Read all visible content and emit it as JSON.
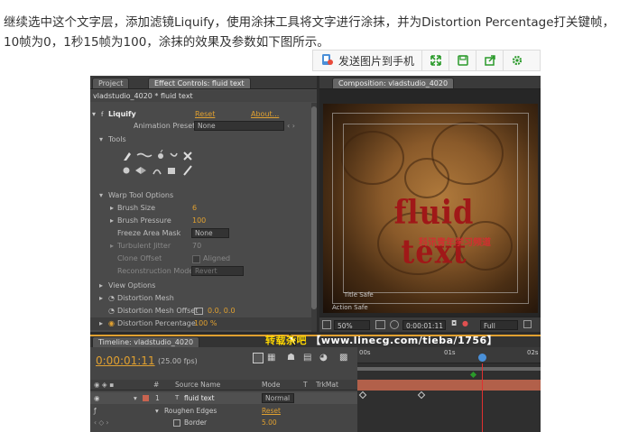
{
  "intro": {
    "text": "继续选中这个文字层，添加滤镜Liquify，使用涂抹工具将文字进行涂抹，并为Distortion Percentage打关键帧，10帧为0，1秒15帧为100，涂抹的效果及参数如下图所示。"
  },
  "sharebar": {
    "send_label": "发送图片到手机",
    "icons": [
      "phone-send-icon",
      "expand-icon",
      "save-icon",
      "share-icon",
      "settings-icon"
    ],
    "accent": "#2a9a2a"
  },
  "ae": {
    "left_tabs": [
      "Project",
      "Effect Controls: fluid text"
    ],
    "layer_path": "vladstudio_4020 * fluid text",
    "effect": {
      "name": "Liquify",
      "reset": "Reset",
      "about": "About...",
      "presets_label": "Animation Presets:",
      "presets_value": "None"
    },
    "tools_label": "Tools",
    "warp_label": "Warp Tool Options",
    "params": [
      {
        "label": "Brush Size",
        "value": "6",
        "active": true
      },
      {
        "label": "Brush Pressure",
        "value": "100",
        "active": true
      },
      {
        "label": "Freeze Area Mask",
        "value": "None",
        "active": true
      },
      {
        "label": "Turbulent Jitter",
        "value": "70",
        "active": false
      },
      {
        "label": "Clone Offset",
        "value": "Aligned",
        "active": false
      },
      {
        "label": "Reconstruction Mode",
        "value": "Revert",
        "active": false
      }
    ],
    "view_options": "View Options",
    "distortion_mesh": "Distortion Mesh",
    "mesh_offset_label": "Distortion Mesh Offset",
    "mesh_offset_value": "0.0, 0.0",
    "distortion_pct_label": "Distortion Percentage",
    "distortion_pct_value": "100 %",
    "comp_tab": "Composition: vladstudio_4020",
    "comp_text": "fluid text",
    "comp_sub": "科讯青年学习频道",
    "title_safe": "Title Safe",
    "action_safe": "Action Safe",
    "zoom": "50%",
    "timecode_small": "0:00:01:11",
    "resolution": "Full",
    "timeline_tab": "Timeline: vladstudio_4020",
    "timecode": "0:00:01:11",
    "fps": "(25.00 fps)",
    "columns": [
      "#",
      "Source Name",
      "Mode",
      "T",
      "TrkMat"
    ],
    "layer_num": "1",
    "layer_name": "fluid text",
    "layer_mode": "Normal",
    "roughen_label": "Roughen Edges",
    "roughen_reset": "Reset",
    "border_label": "Border",
    "border_value": "5.00",
    "ruler": [
      "00s",
      "01s",
      "02s"
    ]
  },
  "watermark": {
    "prefix": "转载杂吧",
    "url": "【www.linecg.com/tieba/1756】"
  }
}
